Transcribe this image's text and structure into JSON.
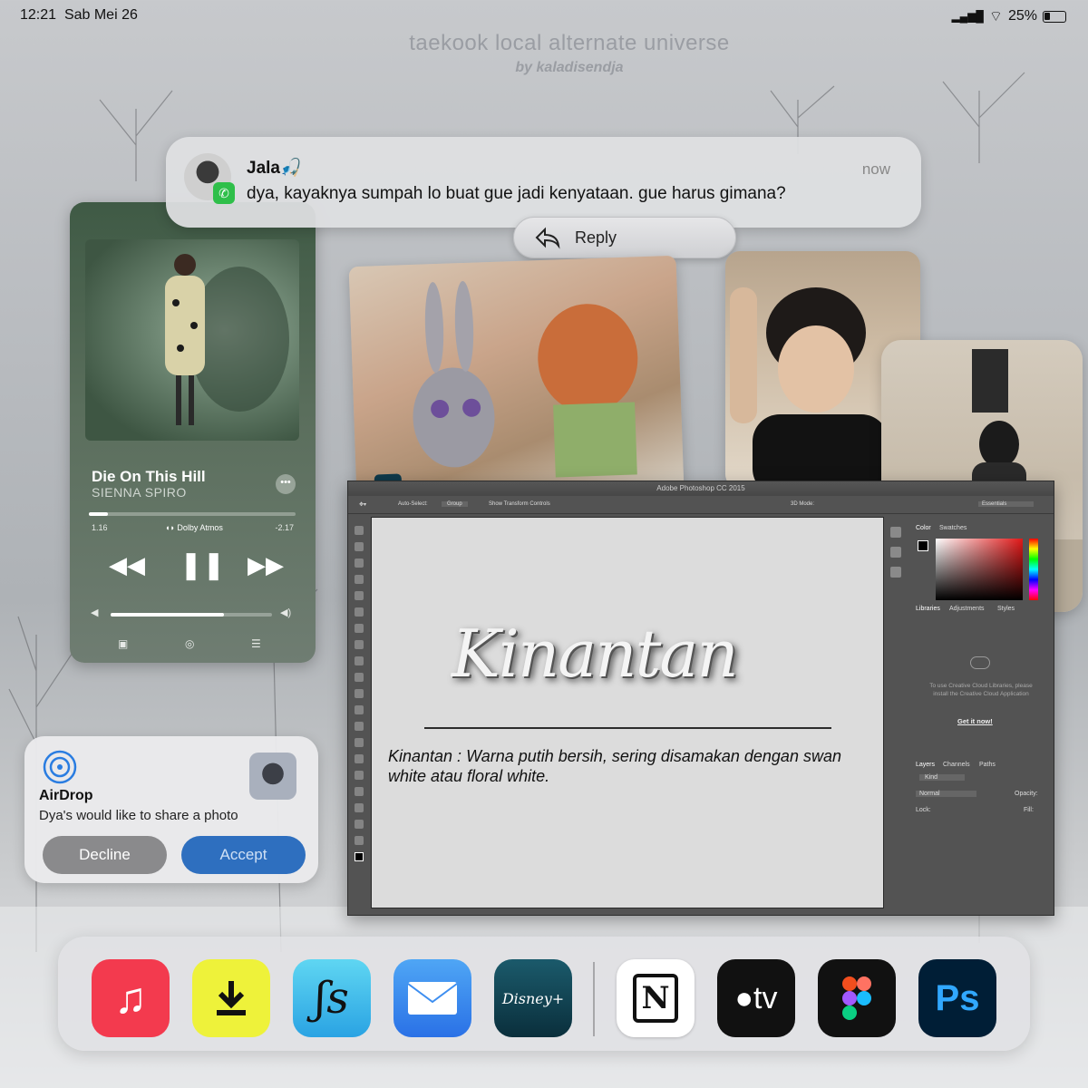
{
  "status_bar": {
    "time": "12:21",
    "date": "Sab Mei 26",
    "battery": "25%"
  },
  "header": {
    "title": "taekook local alternate universe",
    "byline": "by kaladisendja"
  },
  "notification": {
    "sender": "Jala🎣",
    "time": "now",
    "message": "dya, kayaknya sumpah lo buat gue jadi kenyataan. gue harus gimana?",
    "reply_label": "Reply"
  },
  "music": {
    "song": "Die On This Hill",
    "artist": "SIENNA SPIRO",
    "elapsed": "1.16",
    "remaining": "-2.17",
    "format": "Dolby Atmos",
    "progress": 0.09,
    "volume": 0.7
  },
  "photoshop": {
    "window_title": "Adobe Photoshop CC 2015",
    "auto_select": "Auto-Select:",
    "group": "Group",
    "transform": "Show Transform Controls",
    "mode": "3D Mode:",
    "workspace": "Essentials",
    "panel_tabs": {
      "color": "Color",
      "swatches": "Swatches",
      "libraries": "Libraries",
      "adjustments": "Adjustments",
      "styles": "Styles",
      "layers": "Layers",
      "channels": "Channels",
      "paths": "Paths"
    },
    "libraries_msg": "To use Creative Cloud Libraries, please install the Creative Cloud Application",
    "get_it": "Get it now!",
    "layers": {
      "kind": "Kind",
      "blend": "Normal",
      "opacity": "Opacity:",
      "lock": "Lock:",
      "fill": "Fill:"
    },
    "canvas": {
      "heading": "Kinantan",
      "description": "Kinantan : Warna putih bersih, sering disamakan dengan swan white atau floral white."
    }
  },
  "airdrop": {
    "title": "AirDrop",
    "subtitle": "Dya's would like to share a photo",
    "decline": "Decline",
    "accept": "Accept"
  },
  "dock": {
    "apps": [
      {
        "name": "music-app-icon",
        "color": "#f33a4e"
      },
      {
        "name": "download-app-icon",
        "color": "#eef23a"
      },
      {
        "name": "font-app-icon",
        "color": "#3cc3ea"
      },
      {
        "name": "mail-app-icon",
        "color": "#3d8ef0"
      },
      {
        "name": "disney-plus-app-icon",
        "color": "#0c3a48",
        "label": "Disney+"
      },
      {
        "name": "notion-app-icon",
        "color": "#ffffff"
      },
      {
        "name": "apple-tv-app-icon",
        "color": "#111111",
        "label": "tv"
      },
      {
        "name": "figma-app-icon",
        "color": "#111111"
      },
      {
        "name": "photoshop-app-icon",
        "color": "#001e36",
        "label": "Ps"
      }
    ]
  }
}
